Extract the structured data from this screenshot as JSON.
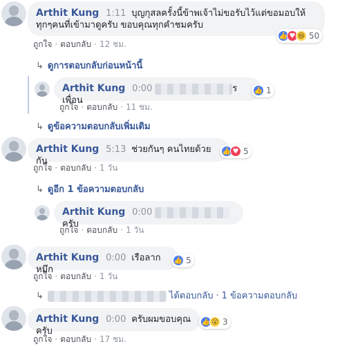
{
  "comments": [
    {
      "name": "Arthit Kung",
      "timestamp": "1:11",
      "text_line1": "บุญกุสลครั้งนี้ข้าพเจ้าไม่ขอรับไว้แต่ขอมอบให้",
      "text_line2": "ทุกๆคนที่เข้ามาดูครับ ขอบคุณทุกคำชมครับ",
      "like_label": "ถูกใจ",
      "reply_label": "ตอบกลับ",
      "time": "12 ชม.",
      "reactions": [
        "like",
        "love",
        "haha"
      ],
      "reaction_count": "50"
    },
    {
      "name": "Arthit Kung",
      "timestamp": "0:00",
      "text_suffix": "รเพื่อน",
      "like_label": "ถูกใจ",
      "reply_label": "ตอบกลับ",
      "time": "11 ชม.",
      "reactions": [
        "like"
      ],
      "reaction_count": "1"
    },
    {
      "name": "Arthit Kung",
      "timestamp": "5:13",
      "text": "ช่วยกันๆ คนไทยด้วยกัน",
      "like_label": "ถูกใจ",
      "reply_label": "ตอบกลับ",
      "time": "1 วัน",
      "reactions": [
        "like",
        "love"
      ],
      "reaction_count": "5"
    },
    {
      "name": "Arthit Kung",
      "timestamp": "0:00",
      "text_suffix": "ครับ",
      "like_label": "ถูกใจ",
      "reply_label": "ตอบกลับ",
      "time": "1 วัน"
    },
    {
      "name": "Arthit Kung",
      "timestamp": "0:00",
      "text": "เรือลากหมึก",
      "like_label": "ถูกใจ",
      "reply_label": "ตอบกลับ",
      "time": "1 วัน",
      "reactions": [
        "like"
      ],
      "reaction_count": "5"
    },
    {
      "name": "Arthit Kung",
      "timestamp": "0:00",
      "text": "ครับผมขอบคุณครับ",
      "like_label": "ถูกใจ",
      "reply_label": "ตอบกลับ",
      "time": "17 ชม.",
      "reactions": [
        "like",
        "wow"
      ],
      "reaction_count": "3"
    }
  ],
  "links": {
    "view_previous_replies": "ดูการตอบกลับก่อนหน้านี้",
    "view_more_replies": "ดูข้อความตอบกลับเพิ่มเติม",
    "view_one_more_reply": "ดูอีก 1 ข้อความตอบกลับ",
    "replied": "ได้ตอบกลับ",
    "one_reply": "1 ข้อความตอบกลับ"
  },
  "icons": {
    "reply_arrow": "reply-arrow-icon",
    "like": "like-icon",
    "love": "love-icon",
    "haha": "haha-icon",
    "wow": "wow-icon"
  },
  "colors": {
    "name_link": "#385898",
    "bubble": "#f2f3f5",
    "like": "#4a7ef7",
    "love": "#f33e58"
  }
}
